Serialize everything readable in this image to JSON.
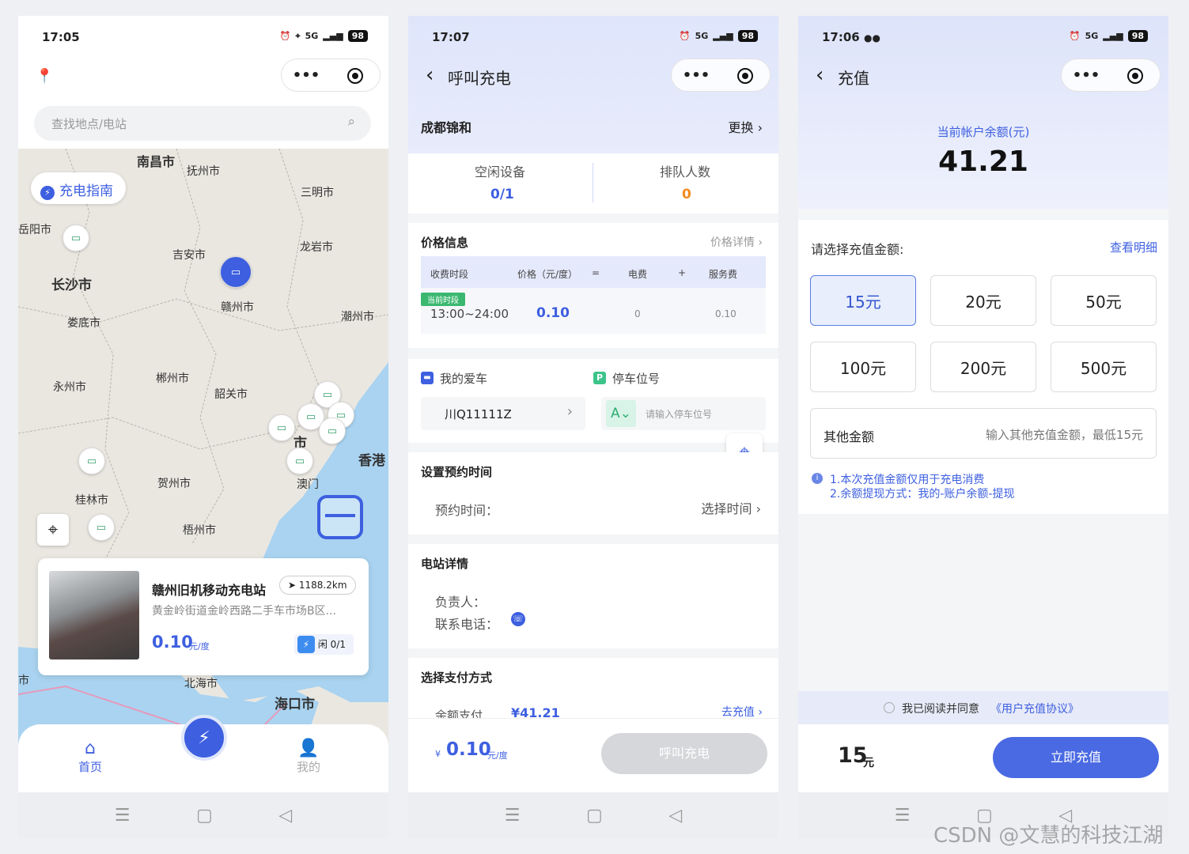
{
  "status": {
    "p1_time": "17:05",
    "p2_time": "17:07",
    "p3_time": "17:06",
    "battery": "98",
    "signal": "5G"
  },
  "capsule": {
    "more": "•••"
  },
  "home": {
    "search_placeholder": "查找地点/电站",
    "guide_label": "充电指南",
    "cities": [
      "南昌市",
      "抚州市",
      "三明市",
      "岳阳市",
      "吉安市",
      "龙岩市",
      "长沙市",
      "赣州市",
      "潮州市",
      "娄底市",
      "永州市",
      "郴州市",
      "韶关市",
      "香港",
      "贺州市",
      "桂林市",
      "澳门",
      "梧州市",
      "北海市",
      "海口市",
      "市",
      "市"
    ],
    "station": {
      "name": "赣州旧机移动充电站",
      "distance": "1188.2km",
      "address": "黄金岭街道金岭西路二手车市场B区...",
      "price": "0.10",
      "unit": "元/度",
      "idle_label": "闲",
      "idle": "0/1"
    },
    "tabs": [
      "首页",
      "我的"
    ]
  },
  "call": {
    "title": "呼叫充电",
    "location": "成都锦和",
    "change": "更换",
    "idle_label": "空闲设备",
    "idle_value": "0/1",
    "queue_label": "排队人数",
    "queue_value": "0",
    "price_title": "价格信息",
    "price_detail": "价格详情",
    "table_headers": [
      "收费时段",
      "价格（元/度）",
      "=",
      "电费",
      "+",
      "服务费"
    ],
    "current_tag": "当前时段",
    "period": "13:00~24:00",
    "price": "0.10",
    "elec": "0",
    "service": "0.10",
    "car_label": "我的爱车",
    "car_value": "川Q11111Z",
    "park_label": "停车位号",
    "park_prefix": "A",
    "park_placeholder": "请输入停车位号",
    "book_title": "设置预约时间",
    "book_label": "预约时间：",
    "book_action": "选择时间",
    "station_title": "电站详情",
    "owner_label": "负责人：",
    "phone_label": "联系电话：",
    "pay_title": "选择支付方式",
    "pay_balance": "余额支付",
    "pay_amount": "¥41.21",
    "recharge": "去充值",
    "bottom_price": "0.10",
    "bottom_unit": "元/度",
    "bottom_currency": "¥",
    "call_button": "呼叫充电"
  },
  "recharge": {
    "title": "充值",
    "balance_label": "当前帐户余额(元)",
    "balance": "41.21",
    "choose_label": "请选择充值金额:",
    "detail_link": "查看明细",
    "amounts": [
      "15元",
      "20元",
      "50元",
      "100元",
      "200元",
      "500元"
    ],
    "other_label": "其他金额",
    "other_placeholder": "输入其他充值金额，最低15元",
    "note1": "1.本次充值金额仅用于充电消费",
    "note2": "2.余额提现方式：我的-账户余额-提现",
    "agree_text": "我已阅读并同意",
    "agree_link": "《用户充值协议》",
    "total": "15",
    "total_unit": "元",
    "submit": "立即充值"
  },
  "watermark": "CSDN @文慧的科技江湖",
  "colors": {
    "accent": "#3d5fe0",
    "orange": "#f28a1c",
    "green": "#3bb870"
  }
}
